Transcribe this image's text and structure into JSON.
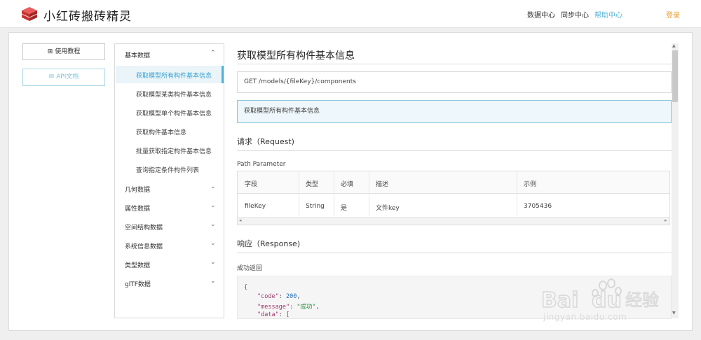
{
  "app": {
    "name": "小红砖搬砖精灵",
    "brand_color": "#d13a3a",
    "accent_color": "#4fb3d9",
    "login_color": "#e8a23a"
  },
  "topnav": {
    "items": [
      {
        "label": "数据中心",
        "active": false
      },
      {
        "label": "同步中心",
        "active": false
      },
      {
        "label": "帮助中心",
        "active": true
      }
    ],
    "login_label": "登录"
  },
  "leftbar": {
    "tutorial_label": "使用教程",
    "tutorial_icon": "book-icon",
    "api_label": "API文档",
    "api_icon": "mail-icon"
  },
  "sidenav": {
    "categories": [
      {
        "label": "基本数据",
        "expanded": true,
        "children": [
          {
            "label": "获取模型所有构件基本信息",
            "active": true
          },
          {
            "label": "获取模型某类构件基本信息",
            "active": false
          },
          {
            "label": "获取模型单个构件基本信息",
            "active": false
          },
          {
            "label": "获取构件基本信息",
            "active": false
          },
          {
            "label": "批量获取指定构件基本信息",
            "active": false
          },
          {
            "label": "查询指定条件构件列表",
            "active": false
          }
        ]
      },
      {
        "label": "几何数据",
        "expanded": false
      },
      {
        "label": "属性数据",
        "expanded": false
      },
      {
        "label": "空间结构数据",
        "expanded": false
      },
      {
        "label": "系统信息数据",
        "expanded": false
      },
      {
        "label": "类型数据",
        "expanded": false
      },
      {
        "label": "glTF数据",
        "expanded": false
      }
    ]
  },
  "doc": {
    "title": "获取模型所有构件基本信息",
    "endpoint": "GET /models/{fileKey}/components",
    "description": "获取模型所有构件基本信息",
    "request_heading": "请求（Request)",
    "path_param_heading": "Path Parameter",
    "table": {
      "headers": [
        "字段",
        "类型",
        "必填",
        "描述",
        "示例"
      ],
      "rows": [
        [
          "fileKey",
          "String",
          "是",
          "文件key",
          "3705436"
        ]
      ]
    },
    "response_heading": "响应（Response)",
    "success_heading": "成功返回",
    "code": {
      "brace": "{",
      "line1_key": "\"code\"",
      "line1_val": "200",
      "line2_key": "\"message\"",
      "line2_val": "\"成功\"",
      "line3_key": "\"data\"",
      "line3_val": "["
    }
  },
  "watermark": {
    "logo_text": "Bai",
    "logo_text2": "du",
    "logo_cn": "经验",
    "url": "jingyan.baidu.com"
  }
}
